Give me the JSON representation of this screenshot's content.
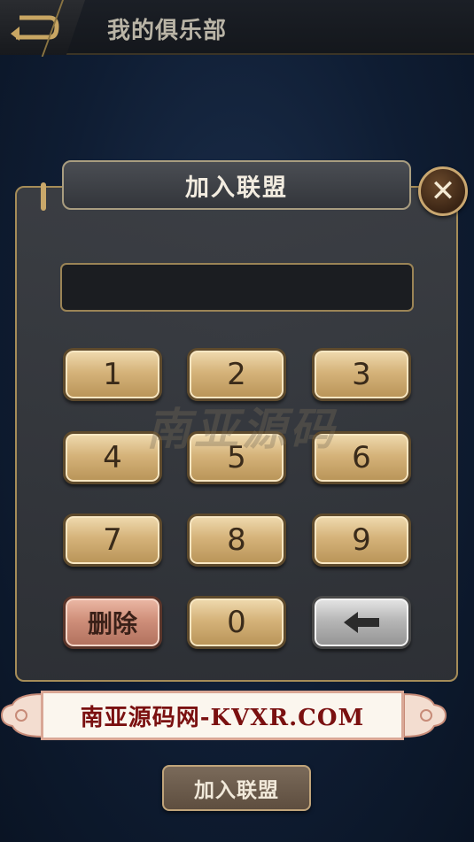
{
  "header": {
    "title": "我的俱乐部",
    "back_icon": "back-arrow-icon"
  },
  "dialog": {
    "title": "加入联盟",
    "close_icon": "close-icon",
    "input_value": "",
    "keypad": {
      "keys": [
        "1",
        "2",
        "3",
        "4",
        "5",
        "6",
        "7",
        "8",
        "9"
      ],
      "delete_label": "删除",
      "zero_label": "0",
      "backspace_icon": "backspace-arrow-icon"
    }
  },
  "watermark": {
    "text": "南亚源码"
  },
  "banner": {
    "text": "南亚源码网-KVXR.COM"
  },
  "footer": {
    "join_label": "加入联盟"
  },
  "colors": {
    "gold": "#c9a86a",
    "key_gold": "#d5b37a",
    "key_delete": "#cf8f7a",
    "key_back": "#b7b7b7"
  }
}
